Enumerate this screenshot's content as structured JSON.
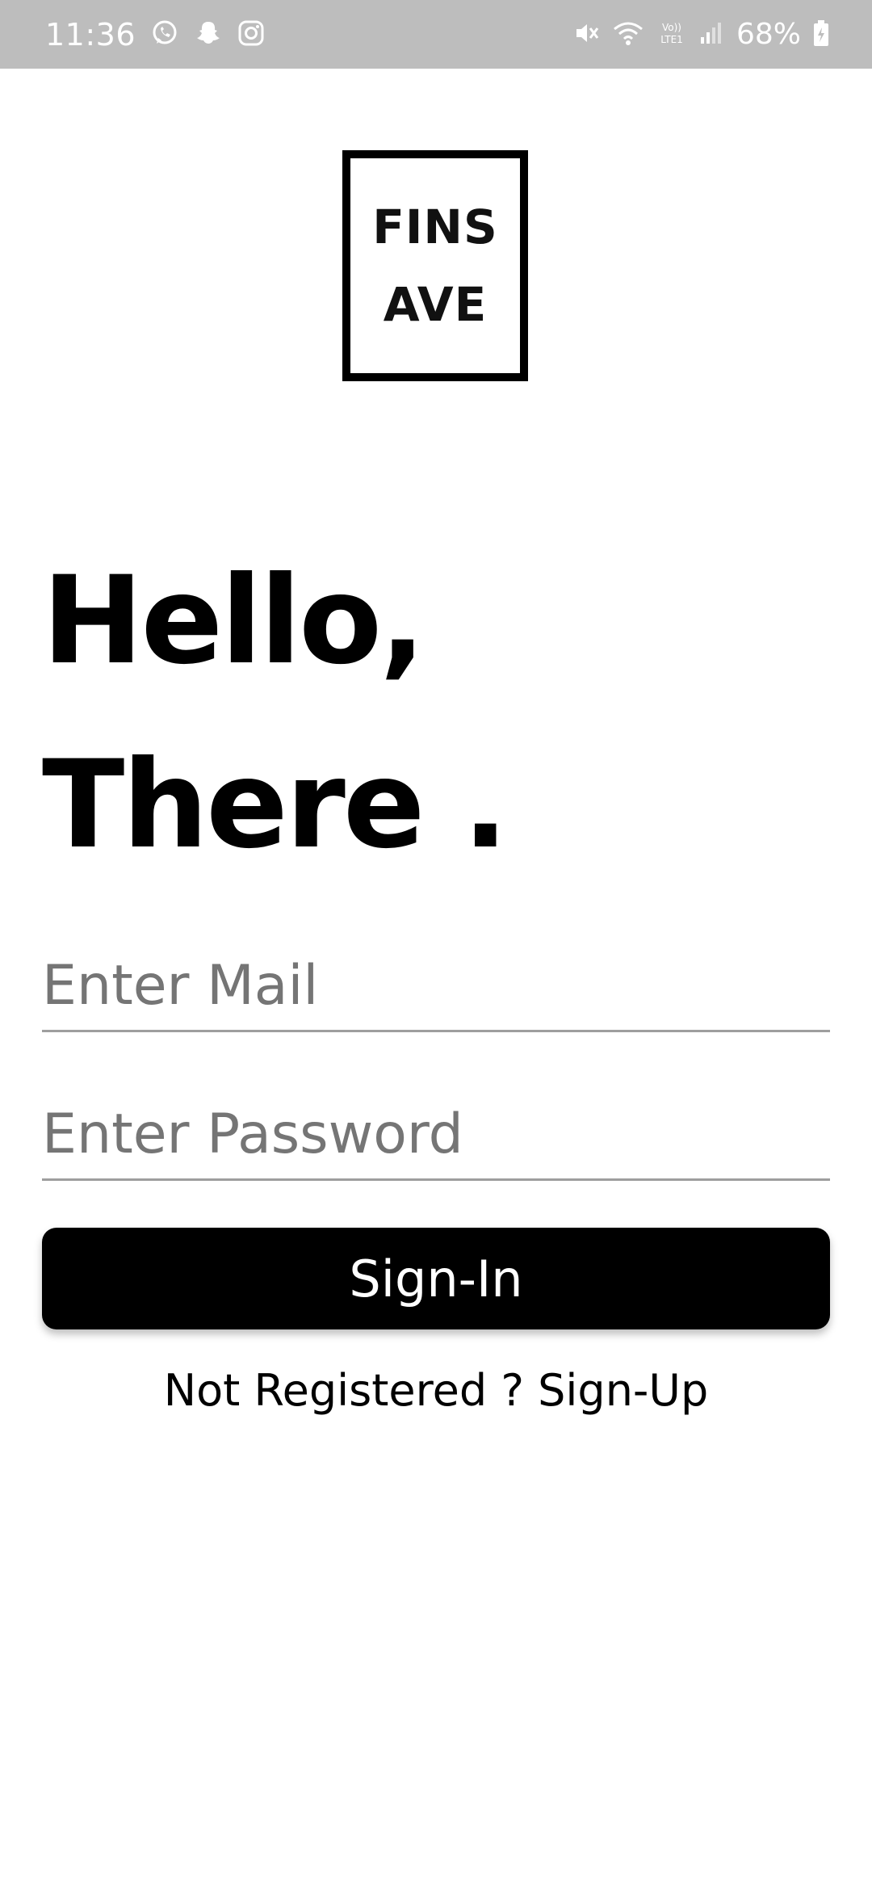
{
  "status_bar": {
    "time": "11:36",
    "battery": "68%",
    "left_icons": [
      "whatsapp-icon",
      "snapchat-icon",
      "instagram-icon"
    ],
    "right_icons": [
      "mute-icon",
      "wifi-icon",
      "volte-lte-icon",
      "signal-icon",
      "battery-charging-icon"
    ],
    "background": "#bdbdbd"
  },
  "logo": {
    "line1": "FINS",
    "line2": "AVE"
  },
  "greeting": {
    "line1": "Hello,",
    "line2": "There ."
  },
  "form": {
    "mail_placeholder": "Enter Mail",
    "mail_value": "",
    "password_placeholder": "Enter Password",
    "password_value": ""
  },
  "actions": {
    "signin_label": "Sign-In",
    "signup_label": "Not Registered ? Sign-Up"
  },
  "colors": {
    "primary": "#000000",
    "background": "#ffffff",
    "placeholder": "#757575",
    "divider": "#9e9e9e"
  }
}
